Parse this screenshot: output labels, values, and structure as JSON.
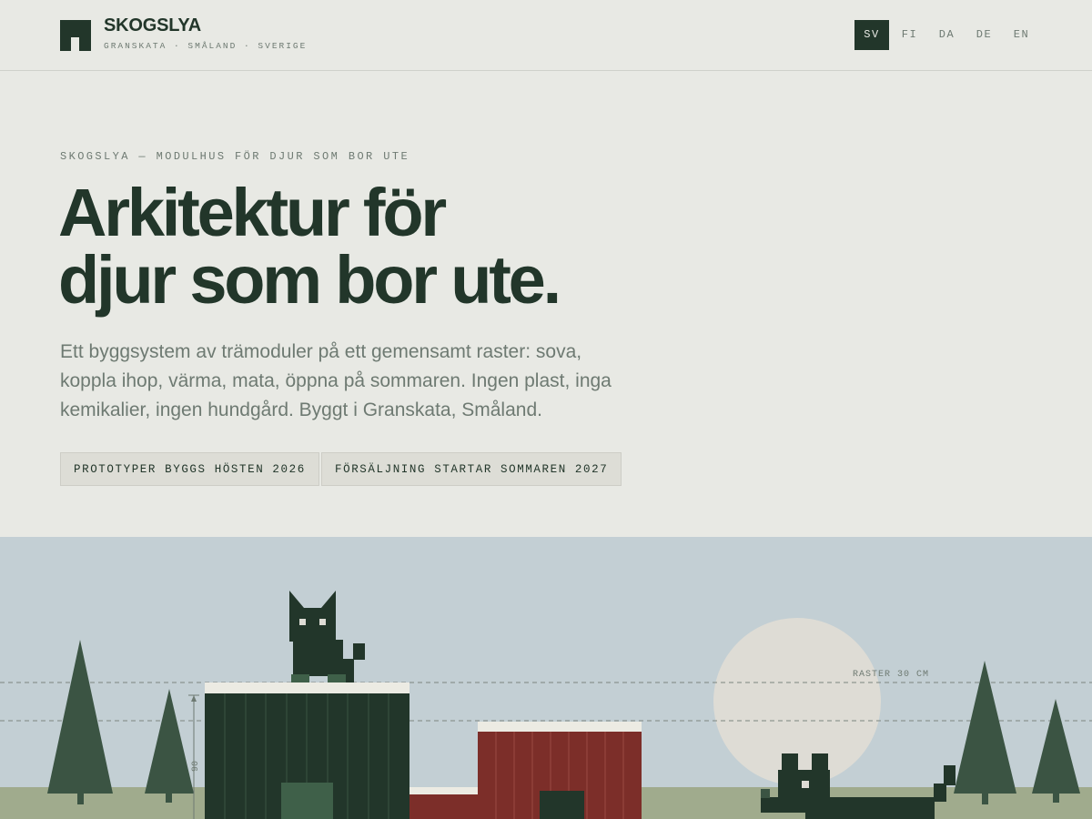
{
  "header": {
    "brand": "SKOGSLYA",
    "tagline": "GRANSKATA · SMÅLAND · SVERIGE",
    "languages": [
      "SV",
      "FI",
      "DA",
      "DE",
      "EN"
    ],
    "active_language": "SV"
  },
  "hero": {
    "eyebrow": "SKOGSLYA — MODULHUS FÖR DJUR SOM BOR UTE",
    "headline_line1": "Arkitektur för",
    "headline_line2": "djur som bor ute.",
    "lead": "Ett byggsystem av trämoduler på ett gemensamt raster: sova, koppla ihop, värma, mata, öppna på sommaren. Ingen plast, inga kemikalier, ingen hundgård. Byggt i Granskata, Småland.",
    "badges": [
      "PROTOTYPER BYGGS HÖSTEN 2026",
      "FÖRSÄLJNING STARTAR SOMMAREN 2027"
    ]
  },
  "illustration": {
    "raster_label": "RASTER 30 CM",
    "dimension_label": "90"
  },
  "colors": {
    "background": "#e8e9e4",
    "ink": "#22362a",
    "muted": "#6e7a72",
    "sky": "#c3cfd4",
    "ground": "#a0ab8d",
    "tree": "#3b5443",
    "barn_red": "#7c2e29",
    "sun": "#dedcd5"
  }
}
